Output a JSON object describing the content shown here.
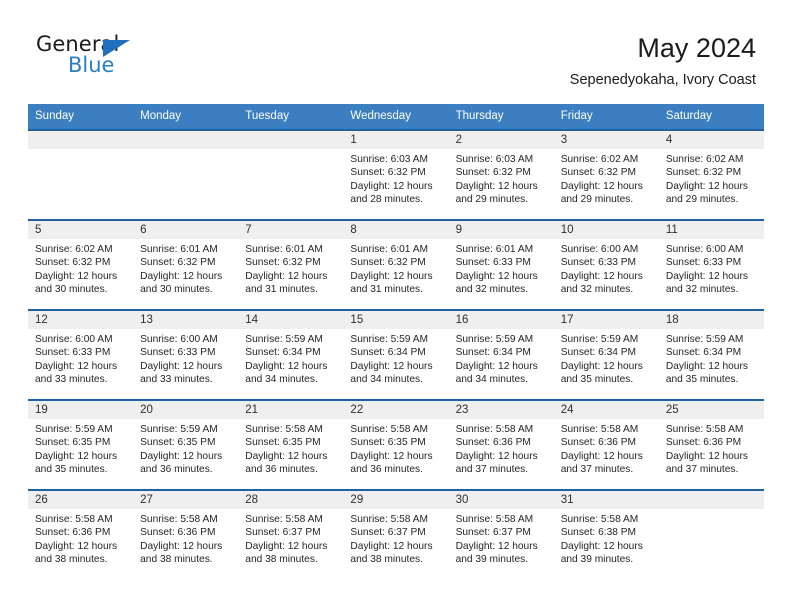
{
  "logo": {
    "word_top": "General",
    "word_bottom": "Blue",
    "triangle_icon": "blue-triangle-icon",
    "brand_blue": "#2a7fc4"
  },
  "header": {
    "title": "May 2024",
    "subtitle": "Sepenedyokaha, Ivory Coast"
  },
  "theme": {
    "header_bg": "#3c7fc1",
    "header_text": "#ffffff",
    "row_divider": "#20629f",
    "day_band_bg": "#efefef"
  },
  "calendar": {
    "weekdays": [
      "Sunday",
      "Monday",
      "Tuesday",
      "Wednesday",
      "Thursday",
      "Friday",
      "Saturday"
    ],
    "weeks": [
      [
        {
          "day": "",
          "empty": true
        },
        {
          "day": "",
          "empty": true
        },
        {
          "day": "",
          "empty": true
        },
        {
          "day": "1",
          "sunrise": "Sunrise: 6:03 AM",
          "sunset": "Sunset: 6:32 PM",
          "daylight1": "Daylight: 12 hours",
          "daylight2": "and 28 minutes."
        },
        {
          "day": "2",
          "sunrise": "Sunrise: 6:03 AM",
          "sunset": "Sunset: 6:32 PM",
          "daylight1": "Daylight: 12 hours",
          "daylight2": "and 29 minutes."
        },
        {
          "day": "3",
          "sunrise": "Sunrise: 6:02 AM",
          "sunset": "Sunset: 6:32 PM",
          "daylight1": "Daylight: 12 hours",
          "daylight2": "and 29 minutes."
        },
        {
          "day": "4",
          "sunrise": "Sunrise: 6:02 AM",
          "sunset": "Sunset: 6:32 PM",
          "daylight1": "Daylight: 12 hours",
          "daylight2": "and 29 minutes."
        }
      ],
      [
        {
          "day": "5",
          "sunrise": "Sunrise: 6:02 AM",
          "sunset": "Sunset: 6:32 PM",
          "daylight1": "Daylight: 12 hours",
          "daylight2": "and 30 minutes."
        },
        {
          "day": "6",
          "sunrise": "Sunrise: 6:01 AM",
          "sunset": "Sunset: 6:32 PM",
          "daylight1": "Daylight: 12 hours",
          "daylight2": "and 30 minutes."
        },
        {
          "day": "7",
          "sunrise": "Sunrise: 6:01 AM",
          "sunset": "Sunset: 6:32 PM",
          "daylight1": "Daylight: 12 hours",
          "daylight2": "and 31 minutes."
        },
        {
          "day": "8",
          "sunrise": "Sunrise: 6:01 AM",
          "sunset": "Sunset: 6:32 PM",
          "daylight1": "Daylight: 12 hours",
          "daylight2": "and 31 minutes."
        },
        {
          "day": "9",
          "sunrise": "Sunrise: 6:01 AM",
          "sunset": "Sunset: 6:33 PM",
          "daylight1": "Daylight: 12 hours",
          "daylight2": "and 32 minutes."
        },
        {
          "day": "10",
          "sunrise": "Sunrise: 6:00 AM",
          "sunset": "Sunset: 6:33 PM",
          "daylight1": "Daylight: 12 hours",
          "daylight2": "and 32 minutes."
        },
        {
          "day": "11",
          "sunrise": "Sunrise: 6:00 AM",
          "sunset": "Sunset: 6:33 PM",
          "daylight1": "Daylight: 12 hours",
          "daylight2": "and 32 minutes."
        }
      ],
      [
        {
          "day": "12",
          "sunrise": "Sunrise: 6:00 AM",
          "sunset": "Sunset: 6:33 PM",
          "daylight1": "Daylight: 12 hours",
          "daylight2": "and 33 minutes."
        },
        {
          "day": "13",
          "sunrise": "Sunrise: 6:00 AM",
          "sunset": "Sunset: 6:33 PM",
          "daylight1": "Daylight: 12 hours",
          "daylight2": "and 33 minutes."
        },
        {
          "day": "14",
          "sunrise": "Sunrise: 5:59 AM",
          "sunset": "Sunset: 6:34 PM",
          "daylight1": "Daylight: 12 hours",
          "daylight2": "and 34 minutes."
        },
        {
          "day": "15",
          "sunrise": "Sunrise: 5:59 AM",
          "sunset": "Sunset: 6:34 PM",
          "daylight1": "Daylight: 12 hours",
          "daylight2": "and 34 minutes."
        },
        {
          "day": "16",
          "sunrise": "Sunrise: 5:59 AM",
          "sunset": "Sunset: 6:34 PM",
          "daylight1": "Daylight: 12 hours",
          "daylight2": "and 34 minutes."
        },
        {
          "day": "17",
          "sunrise": "Sunrise: 5:59 AM",
          "sunset": "Sunset: 6:34 PM",
          "daylight1": "Daylight: 12 hours",
          "daylight2": "and 35 minutes."
        },
        {
          "day": "18",
          "sunrise": "Sunrise: 5:59 AM",
          "sunset": "Sunset: 6:34 PM",
          "daylight1": "Daylight: 12 hours",
          "daylight2": "and 35 minutes."
        }
      ],
      [
        {
          "day": "19",
          "sunrise": "Sunrise: 5:59 AM",
          "sunset": "Sunset: 6:35 PM",
          "daylight1": "Daylight: 12 hours",
          "daylight2": "and 35 minutes."
        },
        {
          "day": "20",
          "sunrise": "Sunrise: 5:59 AM",
          "sunset": "Sunset: 6:35 PM",
          "daylight1": "Daylight: 12 hours",
          "daylight2": "and 36 minutes."
        },
        {
          "day": "21",
          "sunrise": "Sunrise: 5:58 AM",
          "sunset": "Sunset: 6:35 PM",
          "daylight1": "Daylight: 12 hours",
          "daylight2": "and 36 minutes."
        },
        {
          "day": "22",
          "sunrise": "Sunrise: 5:58 AM",
          "sunset": "Sunset: 6:35 PM",
          "daylight1": "Daylight: 12 hours",
          "daylight2": "and 36 minutes."
        },
        {
          "day": "23",
          "sunrise": "Sunrise: 5:58 AM",
          "sunset": "Sunset: 6:36 PM",
          "daylight1": "Daylight: 12 hours",
          "daylight2": "and 37 minutes."
        },
        {
          "day": "24",
          "sunrise": "Sunrise: 5:58 AM",
          "sunset": "Sunset: 6:36 PM",
          "daylight1": "Daylight: 12 hours",
          "daylight2": "and 37 minutes."
        },
        {
          "day": "25",
          "sunrise": "Sunrise: 5:58 AM",
          "sunset": "Sunset: 6:36 PM",
          "daylight1": "Daylight: 12 hours",
          "daylight2": "and 37 minutes."
        }
      ],
      [
        {
          "day": "26",
          "sunrise": "Sunrise: 5:58 AM",
          "sunset": "Sunset: 6:36 PM",
          "daylight1": "Daylight: 12 hours",
          "daylight2": "and 38 minutes."
        },
        {
          "day": "27",
          "sunrise": "Sunrise: 5:58 AM",
          "sunset": "Sunset: 6:36 PM",
          "daylight1": "Daylight: 12 hours",
          "daylight2": "and 38 minutes."
        },
        {
          "day": "28",
          "sunrise": "Sunrise: 5:58 AM",
          "sunset": "Sunset: 6:37 PM",
          "daylight1": "Daylight: 12 hours",
          "daylight2": "and 38 minutes."
        },
        {
          "day": "29",
          "sunrise": "Sunrise: 5:58 AM",
          "sunset": "Sunset: 6:37 PM",
          "daylight1": "Daylight: 12 hours",
          "daylight2": "and 38 minutes."
        },
        {
          "day": "30",
          "sunrise": "Sunrise: 5:58 AM",
          "sunset": "Sunset: 6:37 PM",
          "daylight1": "Daylight: 12 hours",
          "daylight2": "and 39 minutes."
        },
        {
          "day": "31",
          "sunrise": "Sunrise: 5:58 AM",
          "sunset": "Sunset: 6:38 PM",
          "daylight1": "Daylight: 12 hours",
          "daylight2": "and 39 minutes."
        },
        {
          "day": "",
          "empty": true
        }
      ]
    ]
  }
}
